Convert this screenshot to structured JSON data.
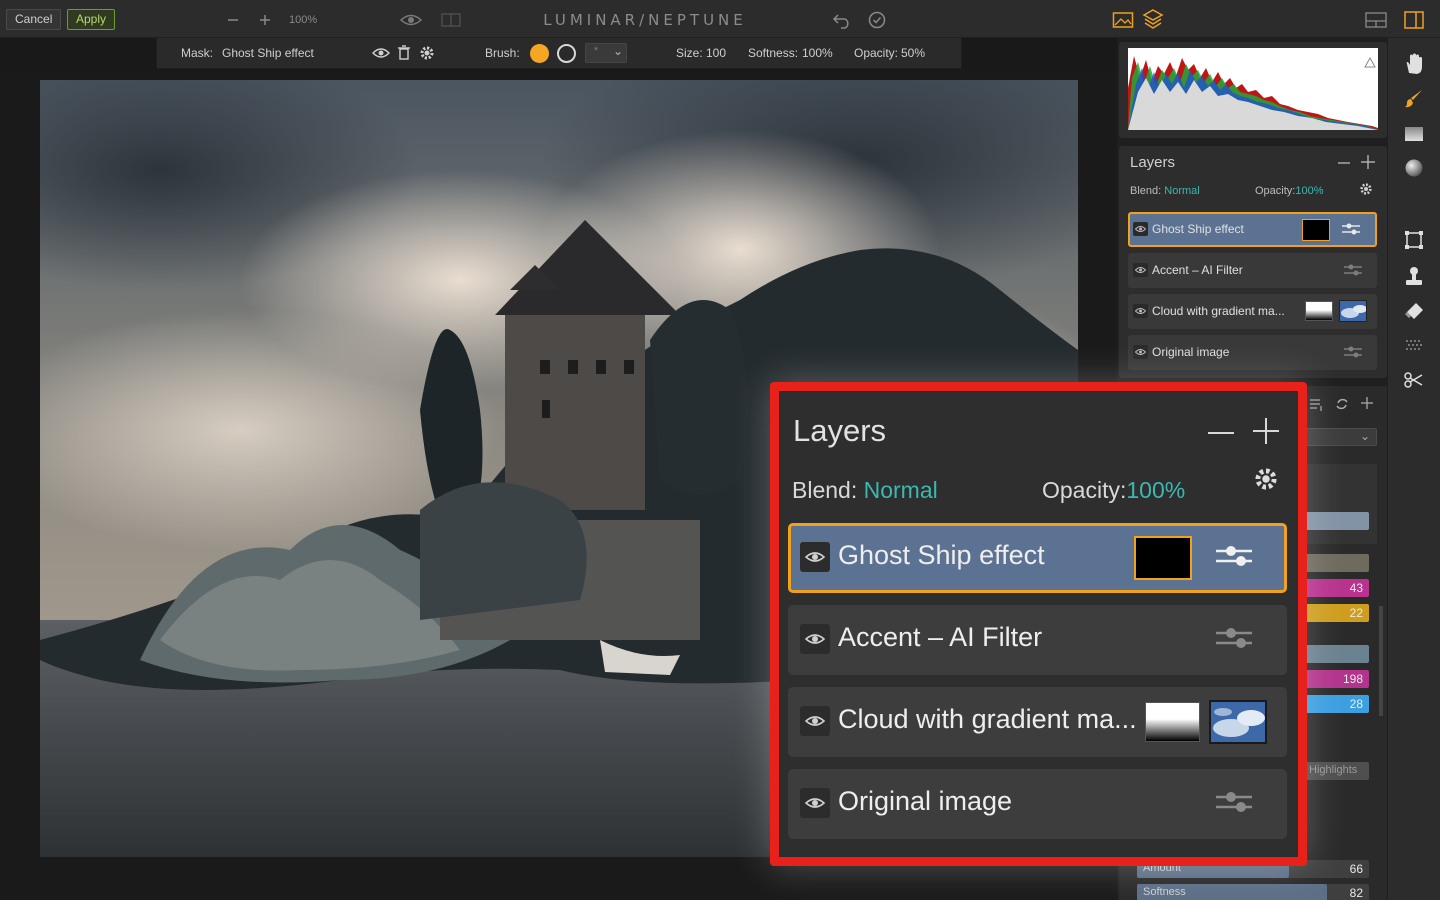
{
  "topbar": {
    "cancel_label": "Cancel",
    "apply_label": "Apply",
    "zoom_level": "100%",
    "brand": "LUMINAR/NEPTUNE"
  },
  "maskbar": {
    "mask_prefix": "Mask:",
    "mask_name": "Ghost Ship effect",
    "brush_label": "Brush:",
    "brush_shape": "*",
    "size_label": "Size:",
    "size_value": "100",
    "softness_label": "Softness:",
    "softness_value": "100%",
    "opacity_label": "Opacity:",
    "opacity_value": "50%"
  },
  "layers_panel": {
    "title": "Layers",
    "blend_label": "Blend:",
    "blend_value": "Normal",
    "opacity_label": "Opacity:",
    "opacity_value": "100%",
    "layers": [
      {
        "name": "Ghost Ship effect",
        "selected": true
      },
      {
        "name": "Accent – AI Filter",
        "selected": false
      },
      {
        "name": "Cloud with gradient ma...",
        "selected": false
      },
      {
        "name": "Original image",
        "selected": false
      }
    ]
  },
  "filters_panel": {
    "values": [
      "43",
      "22",
      "198",
      "28"
    ],
    "highlights_label": "Highlights",
    "amount_label": "Amount",
    "amount_value": "66",
    "softness_label": "Softness",
    "softness_value": "82"
  },
  "colors": {
    "accent_orange": "#f0a21f",
    "accent_teal": "#3bb8b0",
    "selected_layer_bg": "#5b7292",
    "callout_border": "#e8221a",
    "apply_green": "#6c9e2c"
  },
  "icons": {
    "topbar": [
      "minus-icon",
      "plus-icon",
      "eye-icon",
      "compare-icon",
      "undo-icon",
      "history-icon",
      "image-icon",
      "layers-icon",
      "layout-icon",
      "panel-icon"
    ],
    "toolstrip": [
      "hand-icon",
      "brush-icon",
      "gradient-icon",
      "radial-icon",
      "crop-icon",
      "clone-icon",
      "eraser-icon",
      "noise-icon",
      "transform-icon"
    ]
  }
}
